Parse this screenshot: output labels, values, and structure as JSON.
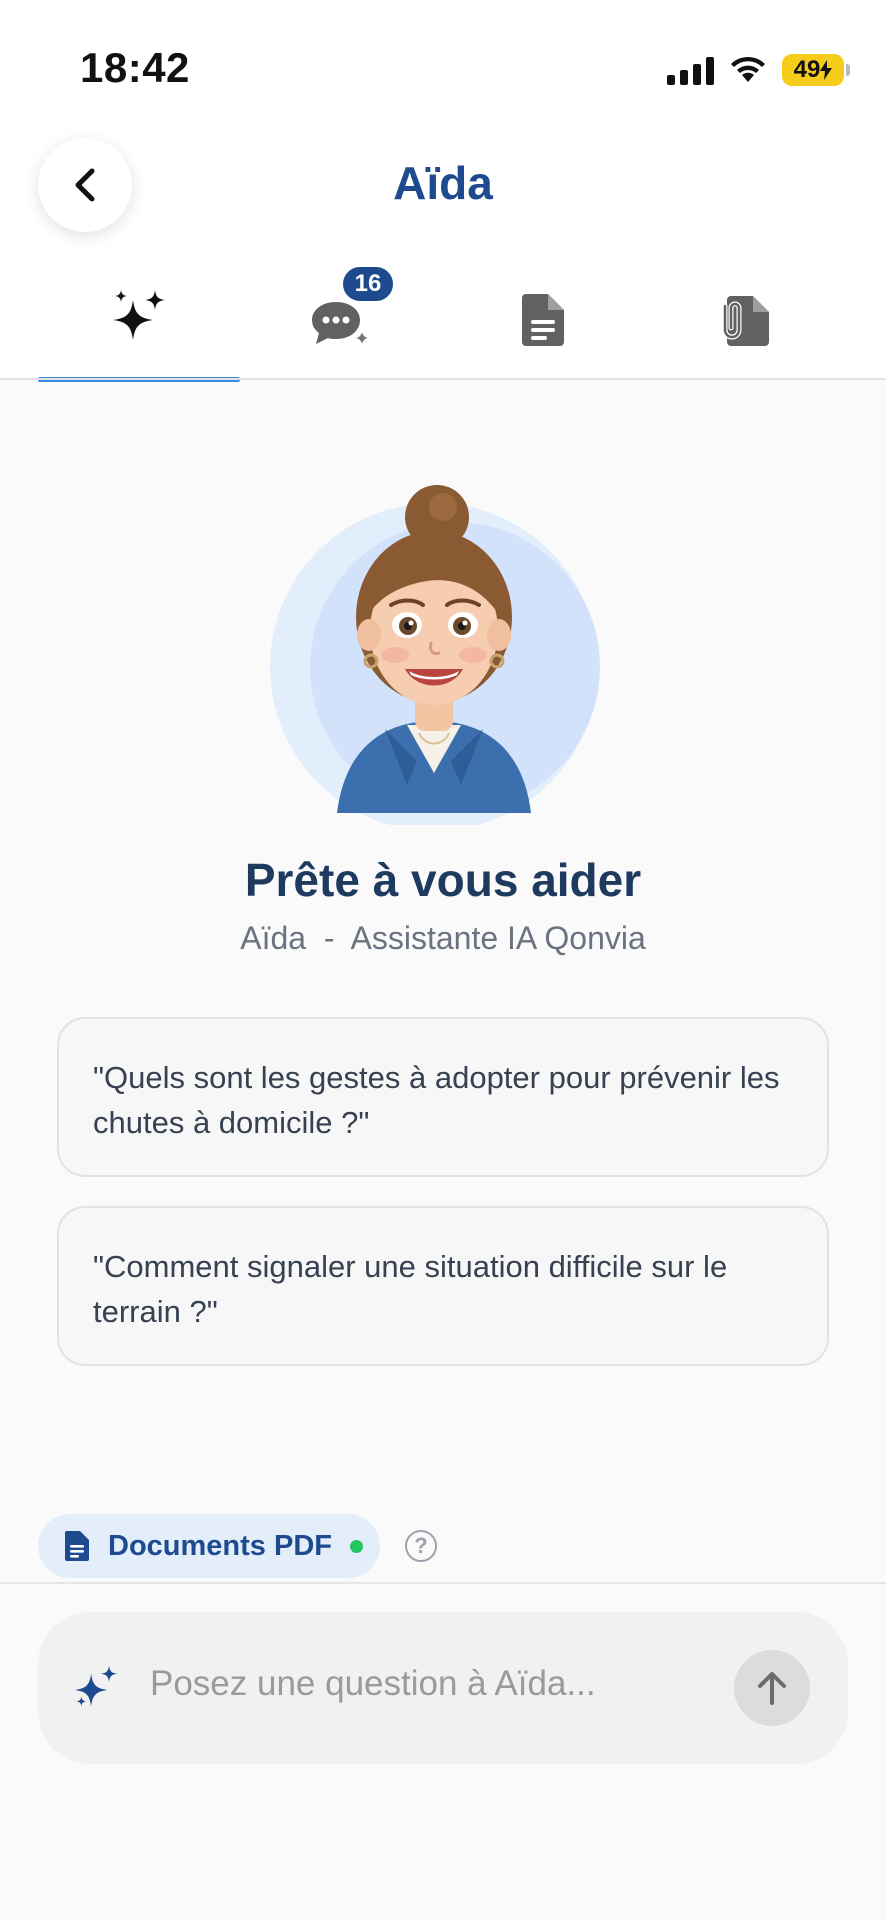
{
  "status_bar": {
    "time": "18:42",
    "battery": "49",
    "battery_color": "#f6cc1a"
  },
  "header": {
    "title": "Aïda",
    "back_icon": "chevron-left-icon"
  },
  "tabs": [
    {
      "icon": "sparkles-icon",
      "active": true
    },
    {
      "icon": "chat-sparkle-icon",
      "badge": "16",
      "active": false
    },
    {
      "icon": "document-icon",
      "active": false
    },
    {
      "icon": "attachment-document-icon",
      "active": false
    }
  ],
  "hero": {
    "title": "Prête à vous aider",
    "subtitle": "Aïda  -  Assistante IA Qonvia"
  },
  "suggestions": [
    "\"Quels sont les gestes à adopter pour prévenir les chutes à domicile ?\"",
    "\"Comment signaler une situation difficile sur le terrain ?\""
  ],
  "doc_chip": {
    "label": "Documents PDF",
    "status_color": "#22c55e"
  },
  "help_icon": "?",
  "input": {
    "placeholder": "Posez une question à Aïda..."
  },
  "colors": {
    "brand": "#1e4a8f",
    "tab_indicator": "#3b8de6"
  }
}
